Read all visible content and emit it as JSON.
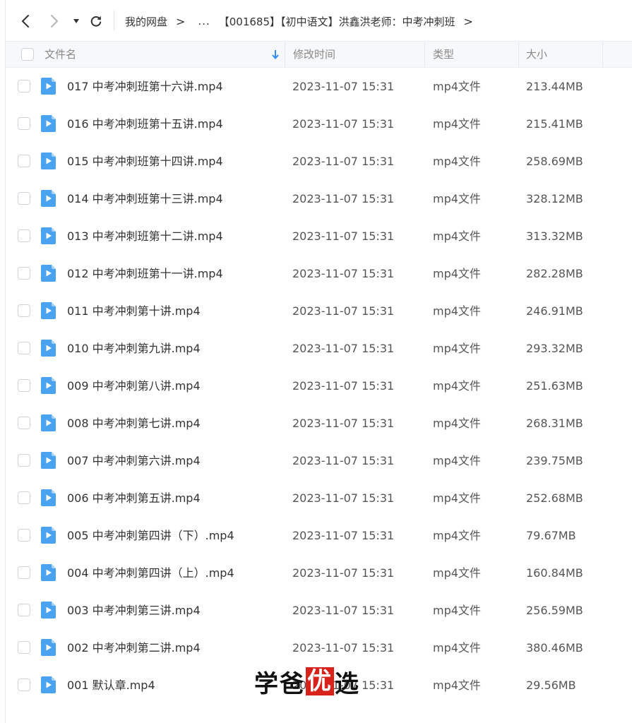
{
  "toolbar": {
    "back_icon": "chevron-left-icon",
    "forward_icon": "chevron-right-icon",
    "history_icon": "caret-down-icon",
    "refresh_icon": "refresh-icon"
  },
  "breadcrumb": {
    "root": "我的网盘",
    "sep": ">",
    "ellipsis": "...",
    "current": "【001685】【初中语文】洪鑫洪老师：中考冲刺班"
  },
  "table": {
    "headers": {
      "name": "文件名",
      "modified": "修改时间",
      "type": "类型",
      "size": "大小"
    },
    "sort_column": "name",
    "rows": [
      {
        "name": "017  中考冲刺班第十六讲.mp4",
        "modified": "2023-11-07 15:31",
        "type": "mp4文件",
        "size": "213.44MB"
      },
      {
        "name": "016  中考冲刺班第十五讲.mp4",
        "modified": "2023-11-07 15:31",
        "type": "mp4文件",
        "size": "215.41MB"
      },
      {
        "name": "015  中考冲刺班第十四讲.mp4",
        "modified": "2023-11-07 15:31",
        "type": "mp4文件",
        "size": "258.69MB"
      },
      {
        "name": "014  中考冲刺班第十三讲.mp4",
        "modified": "2023-11-07 15:31",
        "type": "mp4文件",
        "size": "328.12MB"
      },
      {
        "name": "013  中考冲刺班第十二讲.mp4",
        "modified": "2023-11-07 15:31",
        "type": "mp4文件",
        "size": "313.32MB"
      },
      {
        "name": "012  中考冲刺班第十一讲.mp4",
        "modified": "2023-11-07 15:31",
        "type": "mp4文件",
        "size": "282.28MB"
      },
      {
        "name": "011  中考冲刺第十讲.mp4",
        "modified": "2023-11-07 15:31",
        "type": "mp4文件",
        "size": "246.91MB"
      },
      {
        "name": "010  中考冲刺第九讲.mp4",
        "modified": "2023-11-07 15:31",
        "type": "mp4文件",
        "size": "293.32MB"
      },
      {
        "name": "009  中考冲刺第八讲.mp4",
        "modified": "2023-11-07 15:31",
        "type": "mp4文件",
        "size": "251.63MB"
      },
      {
        "name": "008  中考冲刺第七讲.mp4",
        "modified": "2023-11-07 15:31",
        "type": "mp4文件",
        "size": "268.31MB"
      },
      {
        "name": "007  中考冲刺第六讲.mp4",
        "modified": "2023-11-07 15:31",
        "type": "mp4文件",
        "size": "239.75MB"
      },
      {
        "name": "006  中考冲刺第五讲.mp4",
        "modified": "2023-11-07 15:31",
        "type": "mp4文件",
        "size": "252.68MB"
      },
      {
        "name": "005  中考冲刺第四讲（下）.mp4",
        "modified": "2023-11-07 15:31",
        "type": "mp4文件",
        "size": "79.67MB"
      },
      {
        "name": "004  中考冲刺第四讲（上）.mp4",
        "modified": "2023-11-07 15:31",
        "type": "mp4文件",
        "size": "160.84MB"
      },
      {
        "name": "003  中考冲刺第三讲.mp4",
        "modified": "2023-11-07 15:31",
        "type": "mp4文件",
        "size": "256.59MB"
      },
      {
        "name": "002  中考冲刺第二讲.mp4",
        "modified": "2023-11-07 15:31",
        "type": "mp4文件",
        "size": "380.46MB"
      },
      {
        "name": "001  默认章.mp4",
        "modified": "2023-11-07 15:31",
        "type": "mp4文件",
        "size": "29.56MB"
      }
    ]
  },
  "watermark": {
    "part1": "学爸",
    "part2": "优",
    "part3": "选"
  },
  "colors": {
    "file_icon": "#4aa3f0",
    "sort_arrow": "#2f8cff",
    "watermark_chip": "#d8231c"
  }
}
